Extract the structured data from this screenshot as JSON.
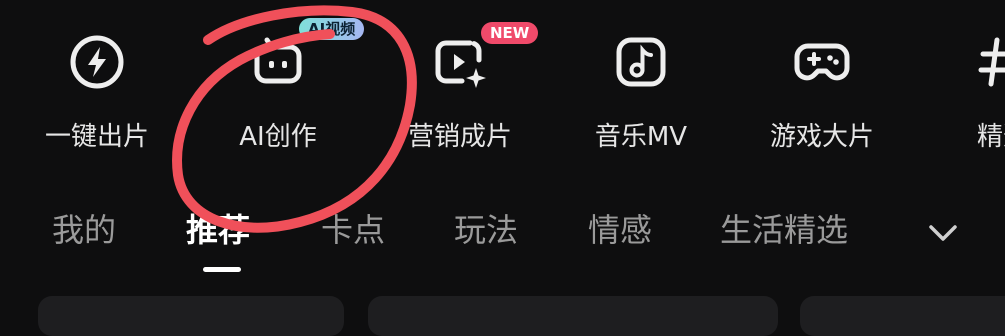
{
  "tools": [
    {
      "label": "一键出片",
      "icon": "lightning-icon"
    },
    {
      "label": "AI创作",
      "icon": "robot-icon",
      "badge": "AI视频"
    },
    {
      "label": "营销成片",
      "icon": "video-sparkle-icon",
      "badge": "NEW"
    },
    {
      "label": "音乐MV",
      "icon": "music-note-icon"
    },
    {
      "label": "游戏大片",
      "icon": "gamepad-icon"
    },
    {
      "label": "精选",
      "icon": "hashtag-icon"
    }
  ],
  "tabs": [
    {
      "label": "我的"
    },
    {
      "label": "推荐",
      "active": true
    },
    {
      "label": "卡点"
    },
    {
      "label": "玩法"
    },
    {
      "label": "情感"
    },
    {
      "label": "生活精选"
    }
  ],
  "colors": {
    "background": "#0e0e0f",
    "annotation_circle": "#f0505a",
    "new_badge": "#f04a6a",
    "ai_badge_gradient": [
      "#7fe0d9",
      "#a6b7f2"
    ]
  }
}
